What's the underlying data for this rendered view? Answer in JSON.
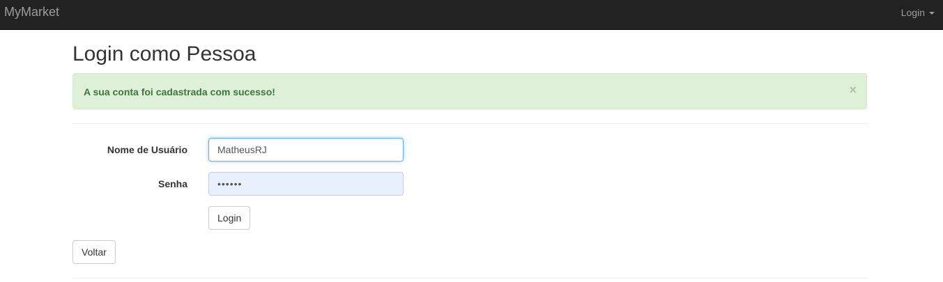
{
  "navbar": {
    "brand": "MyMarket",
    "login_menu": "Login",
    "login_menu_icon": "caret-down-icon"
  },
  "page": {
    "title": "Login como Pessoa"
  },
  "alert": {
    "message": "A sua conta foi cadastrada com sucesso!",
    "close_symbol": "×",
    "type": "success",
    "color": "#3c763d",
    "background": "#dff0d8"
  },
  "form": {
    "username_label": "Nome de Usuário",
    "username_value": "MatheusRJ",
    "password_label": "Senha",
    "password_value": "••••••",
    "submit_label": "Login"
  },
  "actions": {
    "back_label": "Voltar"
  }
}
